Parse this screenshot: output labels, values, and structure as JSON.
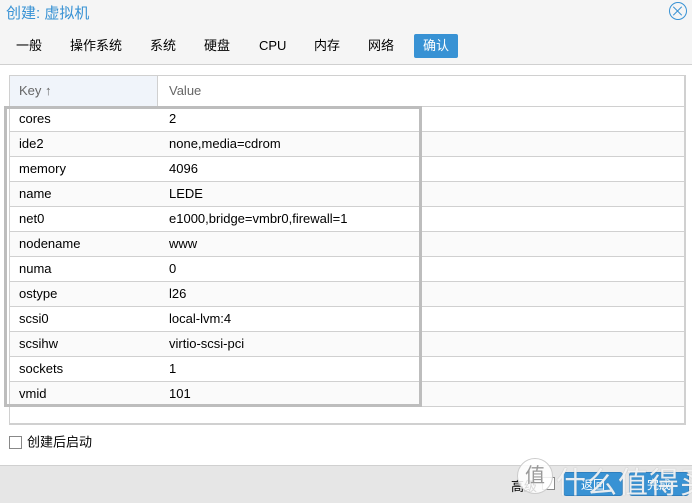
{
  "window": {
    "title": "创建: 虚拟机",
    "close_icon": "close-circle-icon"
  },
  "tabs": [
    {
      "label": "一般",
      "active": false
    },
    {
      "label": "操作系统",
      "active": false
    },
    {
      "label": "系统",
      "active": false
    },
    {
      "label": "硬盘",
      "active": false
    },
    {
      "label": "CPU",
      "active": false
    },
    {
      "label": "内存",
      "active": false
    },
    {
      "label": "网络",
      "active": false
    },
    {
      "label": "确认",
      "active": true
    }
  ],
  "grid": {
    "columns": {
      "key": "Key ↑",
      "value": "Value"
    },
    "rows": [
      {
        "key": "cores",
        "value": "2"
      },
      {
        "key": "ide2",
        "value": "none,media=cdrom"
      },
      {
        "key": "memory",
        "value": "4096"
      },
      {
        "key": "name",
        "value": "LEDE"
      },
      {
        "key": "net0",
        "value": "e1000,bridge=vmbr0,firewall=1"
      },
      {
        "key": "nodename",
        "value": "www"
      },
      {
        "key": "numa",
        "value": "0"
      },
      {
        "key": "ostype",
        "value": "l26"
      },
      {
        "key": "scsi0",
        "value": "local-lvm:4"
      },
      {
        "key": "scsihw",
        "value": "virtio-scsi-pci"
      },
      {
        "key": "sockets",
        "value": "1"
      },
      {
        "key": "vmid",
        "value": "101"
      }
    ]
  },
  "start_after_create": {
    "label": "创建后启动",
    "checked": false
  },
  "footer": {
    "advanced_label": "高级",
    "advanced_checked": false,
    "back_label": "返回",
    "finish_label": "完成",
    "watermark": "什么值得买",
    "watermark_badge": "值"
  },
  "colors": {
    "accent": "#3892d4"
  }
}
